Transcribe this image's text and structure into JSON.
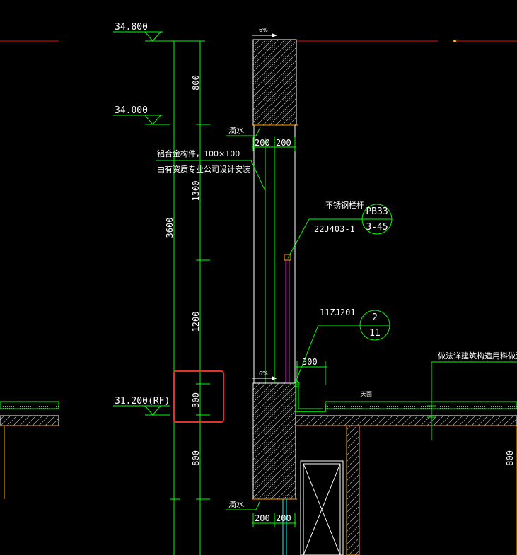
{
  "elevations": {
    "top": "34.800",
    "mid": "34.000",
    "roof": "31.200(RF)"
  },
  "dimensions": {
    "seg_800_top": "800",
    "seg_1300": "1300",
    "total_3600": "3600",
    "seg_1200": "1200",
    "seg_300": "300",
    "seg_800_bottom": "800",
    "right_800": "800",
    "width_200_a": "200",
    "width_200_b": "200",
    "width_200_c": "200",
    "width_200_d": "200",
    "gutter_300": "300"
  },
  "slopes": {
    "top": "6%",
    "bottom": "6%"
  },
  "annotations": {
    "drip_top": "滴水",
    "drip_bottom": "滴水",
    "aluminum_line1": "铝合金构件，100×100",
    "aluminum_line2": "由有资质专业公司设计安装",
    "railing_label": "不锈钢栏杆",
    "railing_ref_code": "22J403-1",
    "railing_ref_top": "PB33",
    "railing_ref_bottom": "3-45",
    "detail_ref_code": "11ZJ201",
    "detail_ref_top": "2",
    "detail_ref_bottom": "11",
    "roof_surface": "天面",
    "note_right": "做法详建筑构造用料做法"
  },
  "colors": {
    "background": "#000000",
    "line_green": "#00ff00",
    "line_white": "#ffffff",
    "line_red": "#ff0000",
    "line_magenta": "#ff00ff",
    "line_cyan": "#00ffff",
    "line_orange": "#ffa000",
    "line_yellow": "#ffff00",
    "highlight": "#e0312a"
  }
}
